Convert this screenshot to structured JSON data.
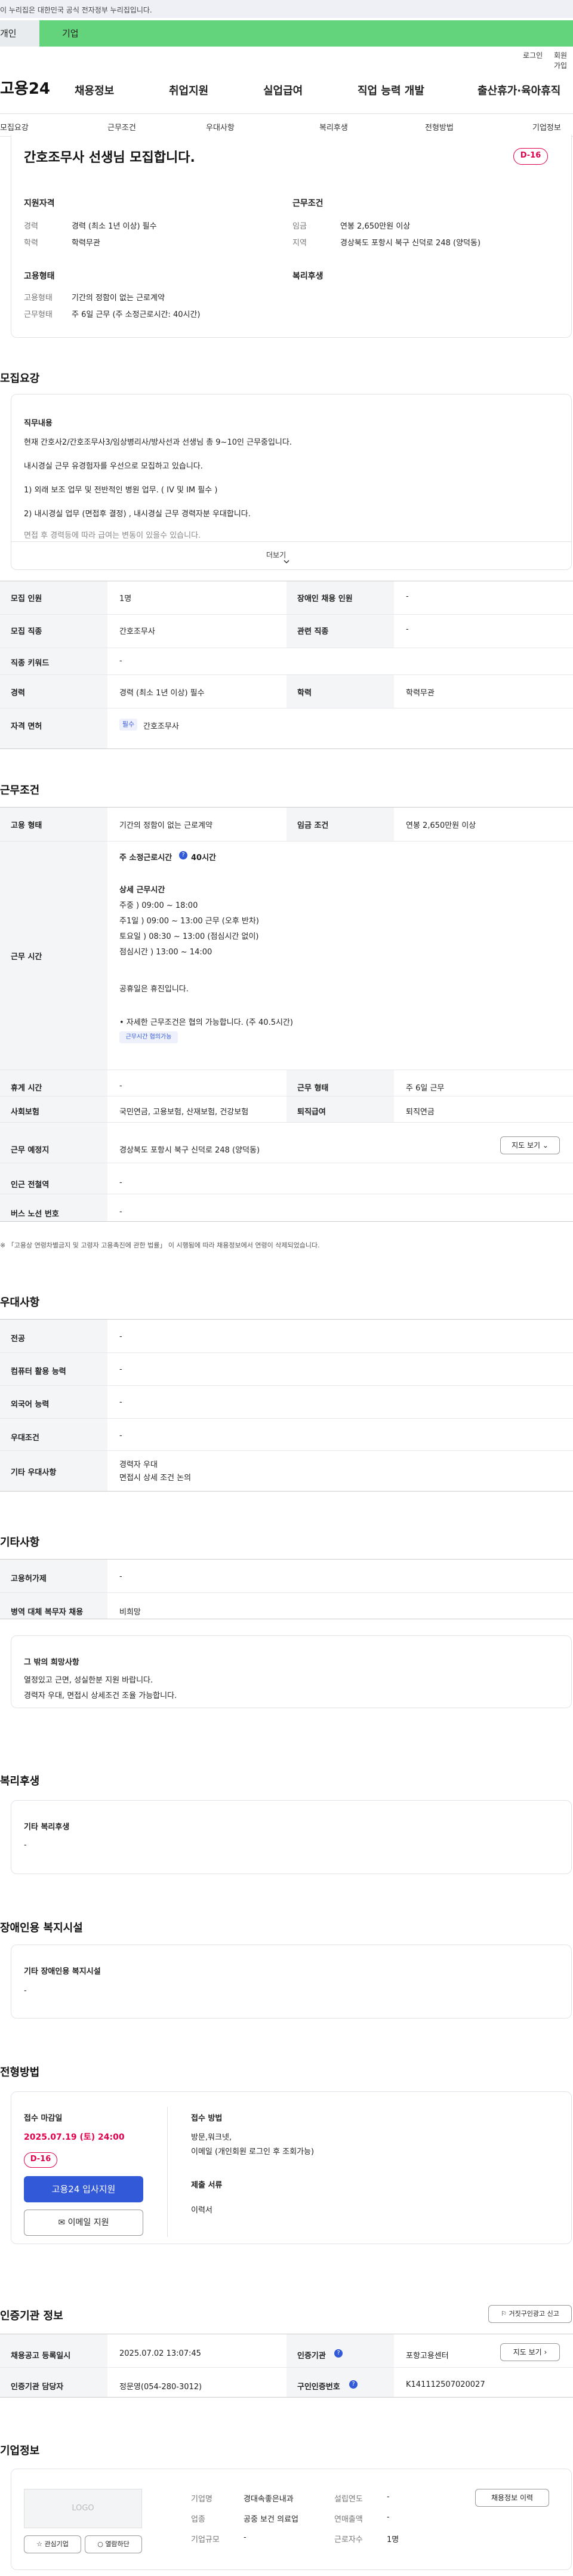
{
  "gov_notice": "이 누리집은 대한민국 공식 전자정부 누리집입니다.",
  "user_tabs": {
    "personal": "개인",
    "company": "기업"
  },
  "util_links": {
    "login": "로그인",
    "signup": "회원가입"
  },
  "logo": "고용24",
  "gnb": [
    "채용정보",
    "취업지원",
    "실업급여",
    "직업 능력 개발",
    "출산휴가·육아휴직"
  ],
  "anchor_nav": [
    "모집요강",
    "근무조건",
    "우대사항",
    "복리후생",
    "전형방법",
    "기업정보"
  ],
  "summary": {
    "title": "간호조무사 선생님 모집합니다.",
    "dday": "D-16",
    "qual_title": "지원자격",
    "qual": [
      {
        "k": "경력",
        "v": "경력 (최소 1년 이상) 필수"
      },
      {
        "k": "학력",
        "v": "학력무관"
      }
    ],
    "cond_title": "근무조건",
    "cond": [
      {
        "k": "임금",
        "v": "연봉 2,650만원 이상"
      },
      {
        "k": "지역",
        "v": "경상북도 포항시 북구 신덕로 248 (양덕동)"
      }
    ],
    "emp_title": "고용형태",
    "emp": [
      {
        "k": "고용형태",
        "v": "기간의 정함이 없는 근로계약"
      },
      {
        "k": "근무형태",
        "v": "주 6일 근무 (주 소정근로시간: 40시간)"
      }
    ],
    "welfare_title": "복리후생"
  },
  "recruit": {
    "section": "모집요강",
    "job_title": "직무내용",
    "job_lines": [
      "현재 간호사2/간호조무사3/임상병리사/방사선과 선생님 총 9~10인 근무중입니다.",
      "내시경실 근무 유경험자를 우선으로 모집하고 있습니다.",
      "1) 외래 보조 업무 및 전반적인 병원 업무. ( IV 및 IM 필수 )",
      "2) 내시경실 업무 (면접후 결정) , 내시경실 근무 경력자분 우대합니다.",
      "면접 후 경력등에 따라 급여는 변동이 있을수 있습니다."
    ],
    "more": "더보기",
    "rows": [
      {
        "l1": "모집 인원",
        "v1": "1명",
        "l2": "장애인 채용 인원",
        "v2": "-"
      },
      {
        "l1": "모집 직종",
        "v1": "간호조무사",
        "l2": "관련 직종",
        "v2": "-"
      },
      {
        "l1": "직종 키워드",
        "v1": "-"
      },
      {
        "l1": "경력",
        "v1": "경력 (최소 1년 이상) 필수",
        "l2": "학력",
        "v2": "학력무관"
      },
      {
        "l1": "자격 면허",
        "tag": "필수",
        "v1": "간호조무사"
      }
    ]
  },
  "conditions": {
    "section": "근무조건",
    "emp_type_l": "고용 형태",
    "emp_type_v": "기간의 정함이 없는 근로계약",
    "wage_l": "임금 조건",
    "wage_v": "연봉 2,650만원 이상",
    "time_l": "근무 시간",
    "weekly": "주 소정근로시간",
    "weekly_v": "40시간",
    "detail_title": "상세 근무시간",
    "detail_lines": [
      "주중 ) 09:00 ~ 18:00",
      "주1일 ) 09:00 ~ 13:00 근무 (오후 반차)",
      "토요일 ) 08:30 ~ 13:00 (점심시간 없이)",
      "점심시간 ) 13:00 ~ 14:00",
      "",
      "공휴일은 휴진입니다."
    ],
    "note": "• 자세한 근무조건은 협의 가능합니다. (주 40.5시간)",
    "note_tag": "근무시간 협의가능",
    "rest_l": "휴게 시간",
    "rest_v": "-",
    "form_l": "근무 형태",
    "form_v": "주 6일 근무",
    "ins_l": "사회보험",
    "ins_v": "국민연금, 고용보험, 산재보험, 건강보험",
    "sev_l": "퇴직급여",
    "sev_v": "퇴직연금",
    "place_l": "근무 예정지",
    "place_v": "경상북도 포항시 북구 신덕로 248 (양덕동)",
    "map_btn": "지도 보기",
    "subway_l": "인근 전철역",
    "subway_v": "-",
    "bus_l": "버스 노선 번호",
    "bus_v": "-",
    "footnote": "※ 「고용상 연령차별금지 및 고령자 고용촉진에 관한 법률」 이 시행됨에 따라 채용정보에서 연령이 삭제되었습니다."
  },
  "prefer": {
    "section": "우대사항",
    "rows": [
      {
        "l": "전공",
        "v": "-"
      },
      {
        "l": "컴퓨터 활용 능력",
        "v": "-"
      },
      {
        "l": "외국어 능력",
        "v": "-"
      },
      {
        "l": "우대조건",
        "v": "-"
      },
      {
        "l": "기타 우대사항",
        "v": "경력자 우대\n면접시 상세 조건 논의"
      }
    ]
  },
  "other": {
    "section": "기타사항",
    "rows": [
      {
        "l": "고용허가제",
        "v": "-"
      },
      {
        "l": "병역 대체 복무자 채용",
        "v": "비희망"
      }
    ],
    "wish_title": "그 밖의 희망사항",
    "wish_lines": [
      "열정있고 근면, 성실한분 지원 바랍니다.",
      "경력자 우대, 면접시 상세조건 조율 가능합니다."
    ]
  },
  "welfare": {
    "section": "복리후생",
    "box_title": "기타 복리후생",
    "box_v": "-"
  },
  "disabled": {
    "section": "장애인용 복지시설",
    "box_title": "기타 장애인용 복지시설",
    "box_v": "-"
  },
  "screening": {
    "section": "전형방법",
    "deadline_l": "접수 마감일",
    "deadline_v": "2025.07.19 (토) 24:00",
    "dday": "D-16",
    "apply_btn": "고용24 입사지원",
    "email_btn": "이메일 지원",
    "method_l": "접수 방법",
    "method_lines": [
      "방문,워크넷,",
      "이메일 (개인회원 로그인 후 조회가능)"
    ],
    "docs_l": "제출 서류",
    "docs_v": "이력서"
  },
  "agency": {
    "section": "인증기관 정보",
    "report_btn": "거짓구인광고 신고",
    "reg_l": "채용공고 등록일시",
    "reg_v": "2025.07.02 13:07:45",
    "org_l": "인증기관",
    "org_v": "포항고용센터",
    "map_btn": "지도 보기",
    "mgr_l": "인증기관 담당자",
    "mgr_v": "정문영(054-280-3012)",
    "no_l": "구인인증번호",
    "no_v": "K141112507020027"
  },
  "company": {
    "section": "기업정보",
    "logo_txt": "LOGO",
    "fav_btn": "관심기업",
    "follow_btn": "열람하단",
    "rows": [
      {
        "l": "기업명",
        "v": "경대속좋은내과"
      },
      {
        "l": "업종",
        "v": "공중 보건 의료업"
      },
      {
        "l": "기업규모",
        "v": "-"
      }
    ],
    "rows2": [
      {
        "l": "설립연도",
        "v": "-"
      },
      {
        "l": "연매출액",
        "v": "-"
      },
      {
        "l": "근로자수",
        "v": "1명"
      }
    ],
    "hist_btn": "채용정보 이력"
  }
}
